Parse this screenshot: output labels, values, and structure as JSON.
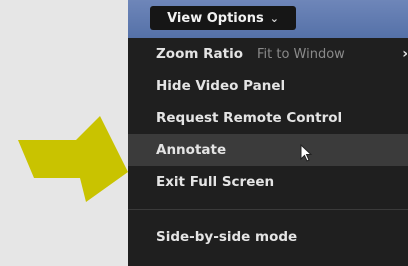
{
  "colors": {
    "arrow": "#c9c300",
    "menu_bg": "#1f1f1f",
    "top_bar": "#6179ae",
    "highlight": "#3b3b3b"
  },
  "icons": {
    "pointer": "arrow-right-icon",
    "cursor": "mouse-cursor-icon",
    "submenu": "chevron-right-icon"
  },
  "toolbar": {
    "view_options_label": "View Options",
    "chevron": "⌄"
  },
  "menu": {
    "zoom_ratio_label": "Zoom Ratio",
    "zoom_ratio_value": "Fit to Window",
    "submenu_arrow": "›",
    "hide_video_panel": "Hide Video Panel",
    "request_remote_control": "Request Remote Control",
    "annotate": "Annotate",
    "exit_full_screen": "Exit Full Screen",
    "side_by_side_mode": "Side-by-side mode"
  }
}
